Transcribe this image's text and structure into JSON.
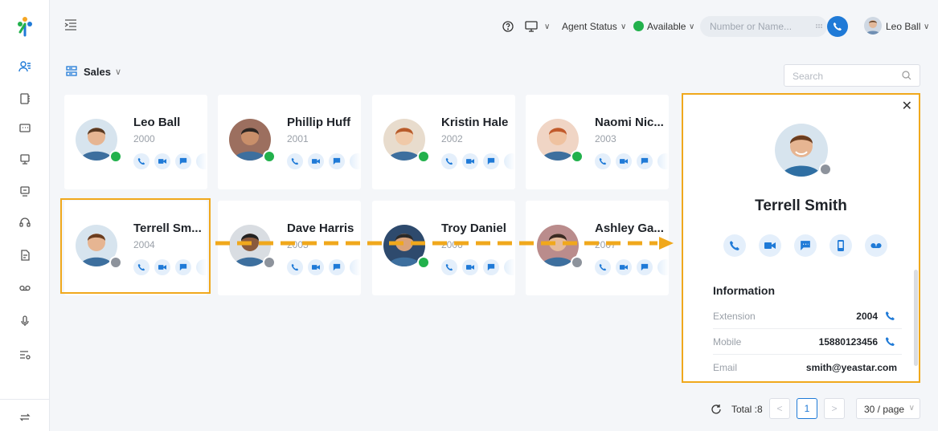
{
  "colors": {
    "accent": "#1f7ad7",
    "online": "#22b14c",
    "offline": "#8d939c",
    "highlight": "#f0a81c"
  },
  "topbar": {
    "agent_status_label": "Agent Status",
    "availability": "Available",
    "search_placeholder": "Number or Name...",
    "user_name": "Leo Ball"
  },
  "group": {
    "name": "Sales"
  },
  "search": {
    "placeholder": "Search"
  },
  "contacts": [
    {
      "name": "Leo Ball",
      "ext": "2000",
      "status": "online"
    },
    {
      "name": "Phillip Huff",
      "ext": "2001",
      "status": "online"
    },
    {
      "name": "Kristin Hale",
      "ext": "2002",
      "status": "online"
    },
    {
      "name": "Naomi Nic...",
      "ext": "2003",
      "status": "online"
    },
    {
      "name": "Terrell Sm...",
      "ext": "2004",
      "status": "offline"
    },
    {
      "name": "Dave Harris",
      "ext": "2005",
      "status": "offline"
    },
    {
      "name": "Troy Daniel",
      "ext": "2006",
      "status": "online"
    },
    {
      "name": "Ashley Ga...",
      "ext": "2007",
      "status": "offline"
    }
  ],
  "detail": {
    "name": "Terrell Smith",
    "info_title": "Information",
    "rows": [
      {
        "label": "Extension",
        "value": "2004"
      },
      {
        "label": "Mobile",
        "value": "15880123456"
      },
      {
        "label": "Email",
        "value": "smith@yeastar.com"
      }
    ]
  },
  "pagination": {
    "total": "Total :8",
    "page": "1",
    "page_size": "30 / page"
  }
}
